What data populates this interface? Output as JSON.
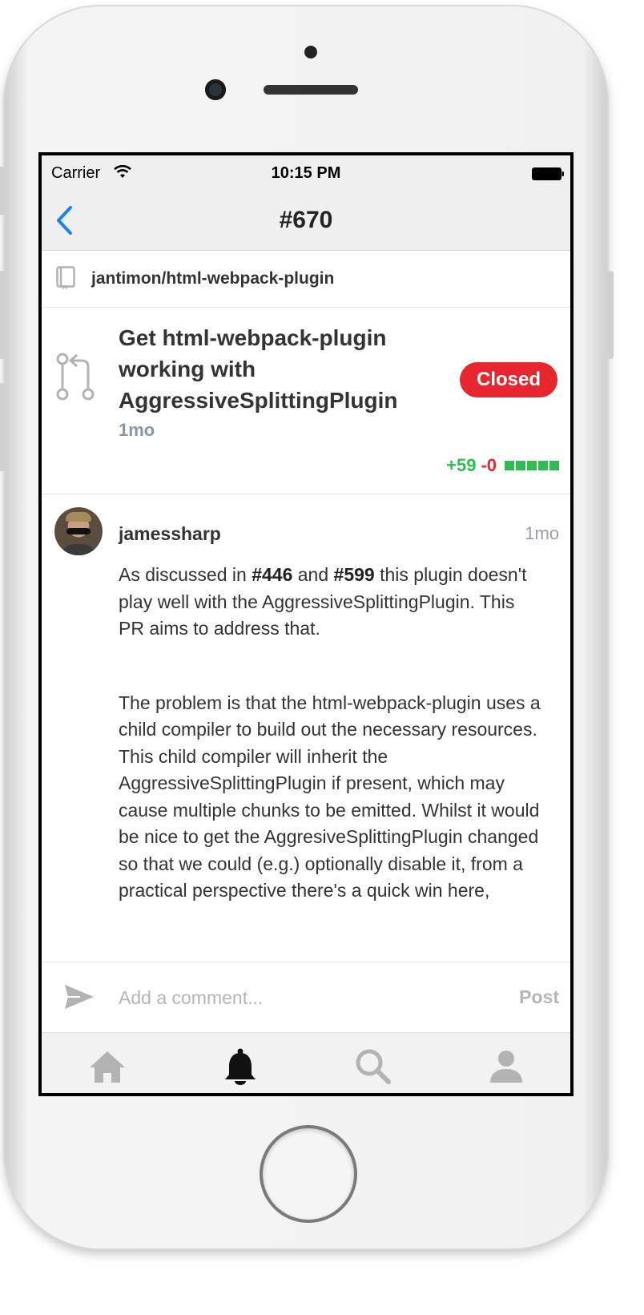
{
  "status_bar": {
    "carrier": "Carrier",
    "time": "10:15 PM",
    "wifi_icon": "wifi-icon",
    "battery_icon": "battery-icon"
  },
  "nav": {
    "back_icon": "chevron-left-icon",
    "title": "#670",
    "accent_color": "#1a82fb"
  },
  "repository": {
    "icon": "repo-icon",
    "name": "jantimon/html-webpack-plugin"
  },
  "pull_request": {
    "icon": "pull-request-icon",
    "title": "Get html-webpack-plugin working with AggressiveSplittingPlugin",
    "age": "1mo",
    "status": "Closed",
    "status_color": "#e8262d",
    "additions": "+59",
    "deletions": "-0",
    "diff_blocks_green": 5,
    "addition_color": "#2ebd4e"
  },
  "comment": {
    "author": "jamessharp",
    "age": "1mo",
    "body": {
      "p1_before": "As discussed in ",
      "p1_ref1": "#446",
      "p1_mid": " and ",
      "p1_ref2": "#599",
      "p1_after": " this plugin doesn't play well with the AggressiveSplittingPlugin. This PR aims to address that.",
      "p2": "The problem is that the html-webpack-plugin uses a child compiler to build out the necessary resources. This child compiler will inherit the AggressiveSplittingPlugin if present, which may cause multiple chunks to be emitted. Whilst it would be nice to get the AggresiveSplittingPlugin changed so that we could (e.g.) optionally disable it, from a practical perspective there's a quick win here,"
    }
  },
  "composer": {
    "send_icon": "send-icon",
    "placeholder": "Add a comment...",
    "post_label": "Post"
  },
  "tab_bar": {
    "tabs": [
      {
        "icon": "home-icon",
        "active": false
      },
      {
        "icon": "bell-icon",
        "active": true
      },
      {
        "icon": "search-icon",
        "active": false
      },
      {
        "icon": "person-icon",
        "active": false
      }
    ]
  }
}
